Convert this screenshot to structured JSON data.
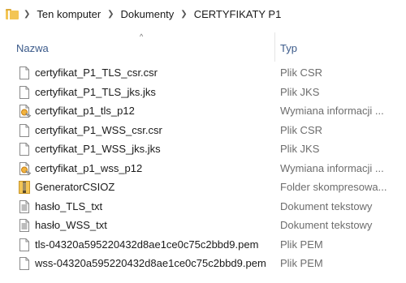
{
  "breadcrumb": {
    "items": [
      "Ten komputer",
      "Dokumenty",
      "CERTYFIKATY P1"
    ]
  },
  "header": {
    "name_label": "Nazwa",
    "type_label": "Typ",
    "sort_indicator": "^"
  },
  "files": [
    {
      "name": "certyfikat_P1_TLS_csr.csr",
      "type": "Plik CSR",
      "icon": "blank-file-icon"
    },
    {
      "name": "certyfikat_P1_TLS_jks.jks",
      "type": "Plik JKS",
      "icon": "blank-file-icon"
    },
    {
      "name": "certyfikat_p1_tls_p12",
      "type": "Wymiana informacji ...",
      "icon": "certificate-file-icon"
    },
    {
      "name": "certyfikat_P1_WSS_csr.csr",
      "type": "Plik CSR",
      "icon": "blank-file-icon"
    },
    {
      "name": "certyfikat_P1_WSS_jks.jks",
      "type": "Plik JKS",
      "icon": "blank-file-icon"
    },
    {
      "name": "certyfikat_p1_wss_p12",
      "type": "Wymiana informacji ...",
      "icon": "certificate-file-icon"
    },
    {
      "name": "GeneratorCSIOZ",
      "type": "Folder skompresowa...",
      "icon": "zip-folder-icon"
    },
    {
      "name": "hasło_TLS_txt",
      "type": "Dokument tekstowy",
      "icon": "text-file-icon"
    },
    {
      "name": "hasło_WSS_txt",
      "type": "Dokument tekstowy",
      "icon": "text-file-icon"
    },
    {
      "name": "tls-04320a595220432d8ae1ce0c75c2bbd9.pem",
      "type": "Plik PEM",
      "icon": "blank-file-icon"
    },
    {
      "name": "wss-04320a595220432d8ae1ce0c75c2bbd9.pem",
      "type": "Plik PEM",
      "icon": "blank-file-icon"
    }
  ],
  "colors": {
    "header_text": "#3b5a8a",
    "type_text": "#6d6d6d",
    "folder": "#f3c555"
  }
}
